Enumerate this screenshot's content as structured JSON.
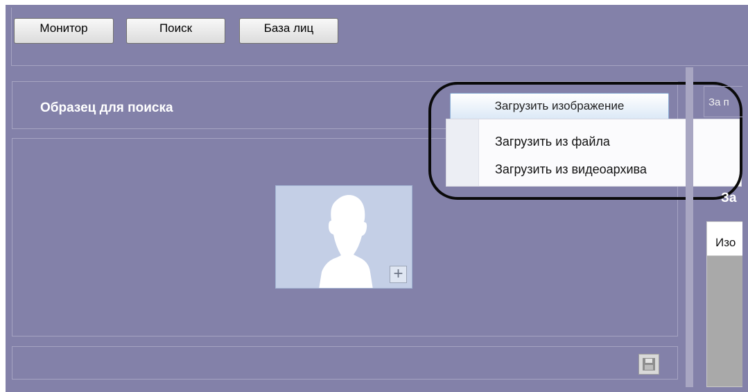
{
  "toolbar": {
    "monitor_label": "Монитор",
    "search_label": "Поиск",
    "faces_db_label": "База лиц"
  },
  "sample_panel": {
    "title": "Образец для поиска",
    "load_image_button": "Загрузить изображение",
    "load_menu": {
      "items": [
        {
          "label": "Загрузить из файла"
        },
        {
          "label": "Загрузить из видеоархива"
        }
      ]
    },
    "placeholder_icon": "person-silhouette-icon",
    "add_icon": "plus-icon",
    "save_icon": "save-disk-icon"
  },
  "right_panel": {
    "header_label": "За п",
    "sub_label": "За",
    "table_header": "Изо"
  },
  "colors": {
    "background": "#8381a9",
    "highlight_button": "#dbe8f6",
    "annotation": "#0a0a0a"
  }
}
